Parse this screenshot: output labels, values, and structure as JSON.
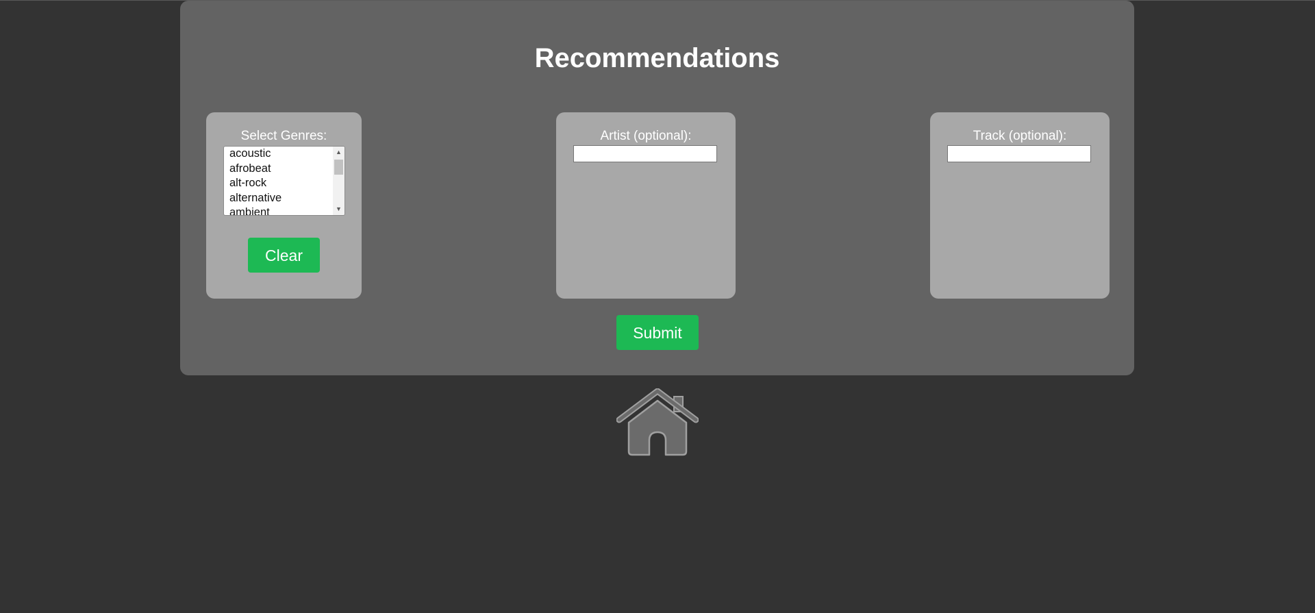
{
  "page": {
    "title": "Recommendations"
  },
  "genres": {
    "label": "Select Genres:",
    "options": [
      "acoustic",
      "afrobeat",
      "alt-rock",
      "alternative",
      "ambient"
    ],
    "clear_label": "Clear"
  },
  "artist": {
    "label": "Artist (optional):",
    "value": ""
  },
  "track": {
    "label": "Track (optional):",
    "value": ""
  },
  "actions": {
    "submit_label": "Submit"
  },
  "icons": {
    "home": "home-icon"
  },
  "colors": {
    "background": "#333333",
    "panel": "#636363",
    "card": "#a8a8a8",
    "accent": "#1db954"
  }
}
